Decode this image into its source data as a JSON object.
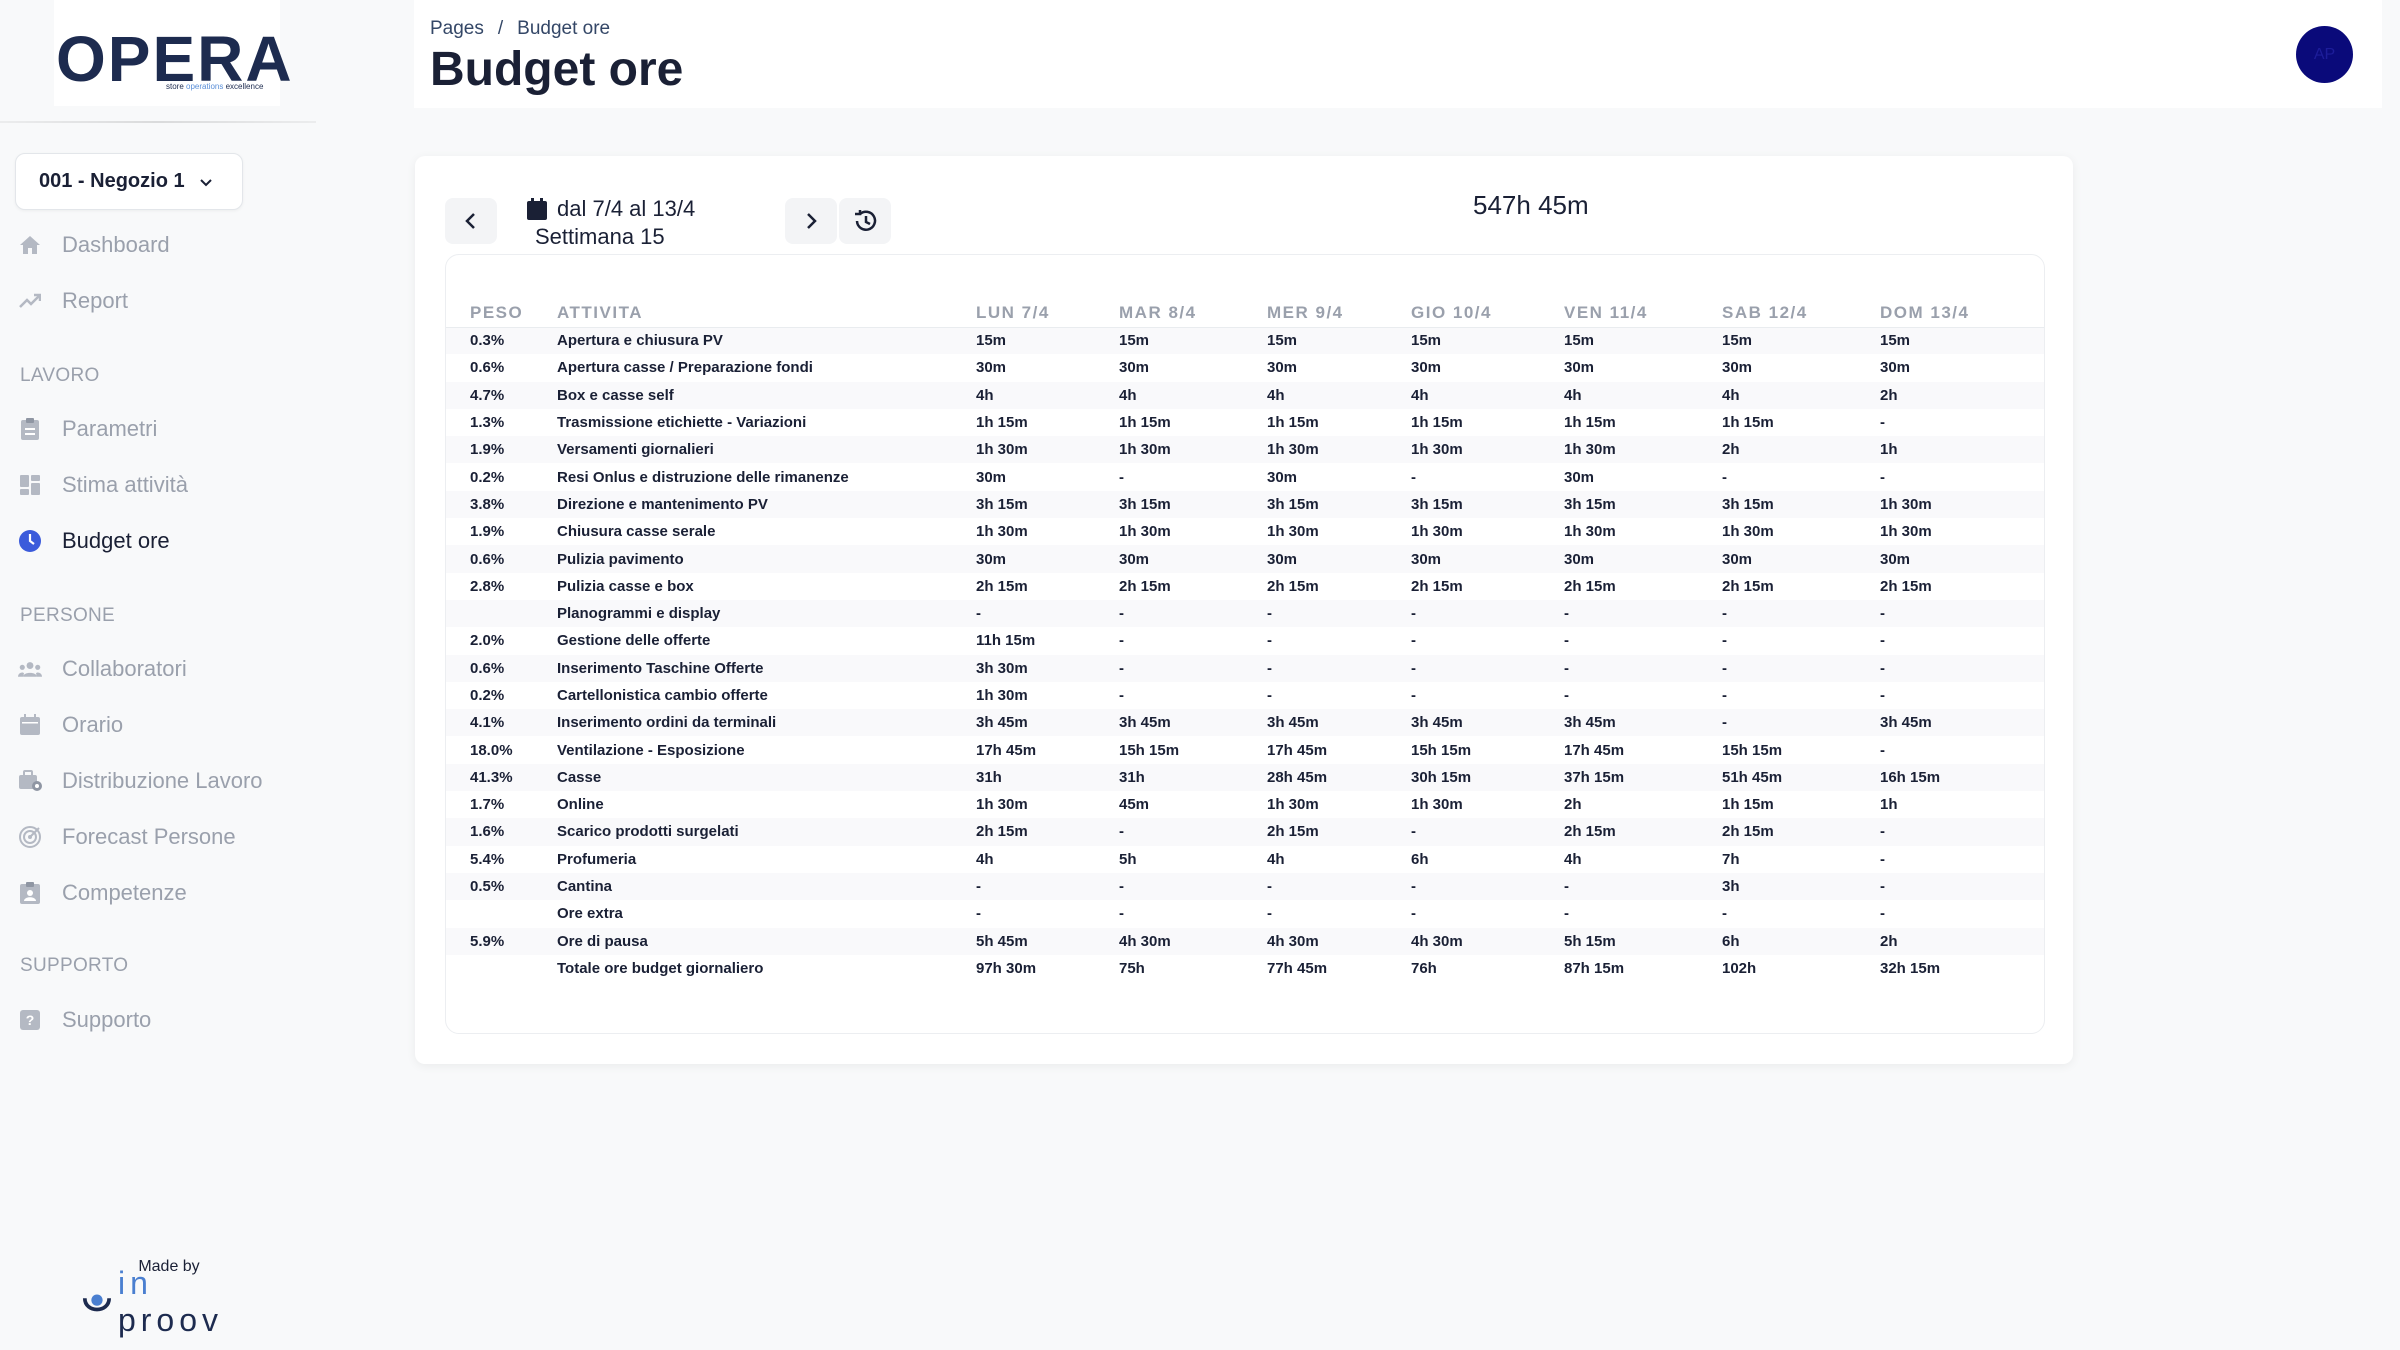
{
  "brand": {
    "logo": "OPERA",
    "tagline_pre": "store ",
    "tagline_hl": "operations",
    "tagline_post": " excellence"
  },
  "store_selector": {
    "label": "001 - Negozio 1"
  },
  "nav": {
    "dashboard": "Dashboard",
    "report": "Report",
    "section_lavoro": "LAVORO",
    "parametri": "Parametri",
    "stima": "Stima attività",
    "budget": "Budget ore",
    "section_persone": "PERSONE",
    "collaboratori": "Collaboratori",
    "orario": "Orario",
    "distribuzione": "Distribuzione Lavoro",
    "forecast": "Forecast Persone",
    "competenze": "Competenze",
    "section_supporto": "SUPPORTO",
    "supporto": "Supporto"
  },
  "footer": {
    "made_by": "Made by",
    "brand_in": "in",
    "brand_rest": "proov"
  },
  "header": {
    "breadcrumb_root": "Pages",
    "breadcrumb_sep": "/",
    "breadcrumb_current": "Budget ore",
    "title": "Budget ore",
    "avatar": "AP"
  },
  "week": {
    "range": "dal 7/4 al 13/4",
    "label": "Settimana 15",
    "total": "547h 45m"
  },
  "table": {
    "headers": [
      "PESO",
      "ATTIVITA",
      "LUN 7/4",
      "MAR 8/4",
      "MER 9/4",
      "GIO 10/4",
      "VEN 11/4",
      "SAB 12/4",
      "DOM 13/4"
    ],
    "rows": [
      [
        "0.3%",
        "Apertura e chiusura PV",
        "15m",
        "15m",
        "15m",
        "15m",
        "15m",
        "15m",
        "15m"
      ],
      [
        "0.6%",
        "Apertura casse / Preparazione fondi",
        "30m",
        "30m",
        "30m",
        "30m",
        "30m",
        "30m",
        "30m"
      ],
      [
        "4.7%",
        "Box e casse self",
        "4h",
        "4h",
        "4h",
        "4h",
        "4h",
        "4h",
        "2h"
      ],
      [
        "1.3%",
        "Trasmissione etichiette - Variazioni",
        "1h 15m",
        "1h 15m",
        "1h 15m",
        "1h 15m",
        "1h 15m",
        "1h 15m",
        "-"
      ],
      [
        "1.9%",
        "Versamenti giornalieri",
        "1h 30m",
        "1h 30m",
        "1h 30m",
        "1h 30m",
        "1h 30m",
        "2h",
        "1h"
      ],
      [
        "0.2%",
        "Resi Onlus e distruzione delle rimanenze",
        "30m",
        "-",
        "30m",
        "-",
        "30m",
        "-",
        "-"
      ],
      [
        "3.8%",
        "Direzione e mantenimento PV",
        "3h 15m",
        "3h 15m",
        "3h 15m",
        "3h 15m",
        "3h 15m",
        "3h 15m",
        "1h 30m"
      ],
      [
        "1.9%",
        "Chiusura casse serale",
        "1h 30m",
        "1h 30m",
        "1h 30m",
        "1h 30m",
        "1h 30m",
        "1h 30m",
        "1h 30m"
      ],
      [
        "0.6%",
        "Pulizia pavimento",
        "30m",
        "30m",
        "30m",
        "30m",
        "30m",
        "30m",
        "30m"
      ],
      [
        "2.8%",
        "Pulizia casse e box",
        "2h 15m",
        "2h 15m",
        "2h 15m",
        "2h 15m",
        "2h 15m",
        "2h 15m",
        "2h 15m"
      ],
      [
        "",
        "Planogrammi e display",
        "-",
        "-",
        "-",
        "-",
        "-",
        "-",
        "-"
      ],
      [
        "2.0%",
        "Gestione delle offerte",
        "11h 15m",
        "-",
        "-",
        "-",
        "-",
        "-",
        "-"
      ],
      [
        "0.6%",
        "Inserimento Taschine Offerte",
        "3h 30m",
        "-",
        "-",
        "-",
        "-",
        "-",
        "-"
      ],
      [
        "0.2%",
        "Cartellonistica cambio offerte",
        "1h 30m",
        "-",
        "-",
        "-",
        "-",
        "-",
        "-"
      ],
      [
        "4.1%",
        "Inserimento ordini da terminali",
        "3h 45m",
        "3h 45m",
        "3h 45m",
        "3h 45m",
        "3h 45m",
        "-",
        "3h 45m"
      ],
      [
        "18.0%",
        "Ventilazione - Esposizione",
        "17h 45m",
        "15h 15m",
        "17h 45m",
        "15h 15m",
        "17h 45m",
        "15h 15m",
        "-"
      ],
      [
        "41.3%",
        "Casse",
        "31h",
        "31h",
        "28h 45m",
        "30h 15m",
        "37h 15m",
        "51h 45m",
        "16h 15m"
      ],
      [
        "1.7%",
        "Online",
        "1h 30m",
        "45m",
        "1h 30m",
        "1h 30m",
        "2h",
        "1h 15m",
        "1h"
      ],
      [
        "1.6%",
        "Scarico prodotti surgelati",
        "2h 15m",
        "-",
        "2h 15m",
        "-",
        "2h 15m",
        "2h 15m",
        "-"
      ],
      [
        "5.4%",
        "Profumeria",
        "4h",
        "5h",
        "4h",
        "6h",
        "4h",
        "7h",
        "-"
      ],
      [
        "0.5%",
        "Cantina",
        "-",
        "-",
        "-",
        "-",
        "-",
        "3h",
        "-"
      ],
      [
        "",
        "Ore extra",
        "-",
        "-",
        "-",
        "-",
        "-",
        "-",
        "-"
      ],
      [
        "5.9%",
        "Ore di pausa",
        "5h 45m",
        "4h 30m",
        "4h 30m",
        "4h 30m",
        "5h 15m",
        "6h",
        "2h"
      ],
      [
        "",
        "Totale ore budget giornaliero",
        "97h 30m",
        "75h",
        "77h 45m",
        "76h",
        "87h 15m",
        "102h",
        "32h 15m"
      ]
    ]
  },
  "colors": {
    "accent": "#1d2b4f",
    "muted": "#9aa0ac",
    "active_icon": "#3b5bdb",
    "avatar": "#0a0a7a"
  }
}
